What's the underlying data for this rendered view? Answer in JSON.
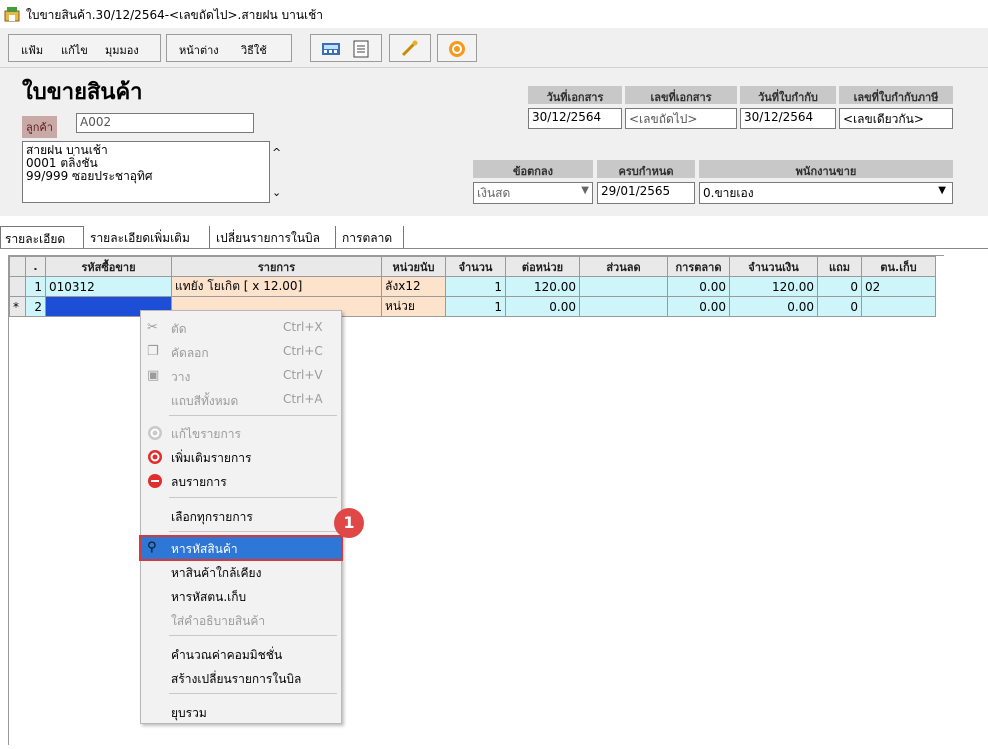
{
  "window": {
    "title": "ใบขายสินค้า.30/12/2564-<เลขถัดไป>.สายฝน บานเช้า"
  },
  "toolbar": {
    "menu": [
      "แฟ้ม",
      "แก้ไข",
      "มุมมอง"
    ],
    "menu2": [
      "หน้าต่าง",
      "วิธีใช้"
    ]
  },
  "document": {
    "heading": "ใบขายสินค้า",
    "customer_label": "ลูกค้า",
    "customer_code": "A002",
    "address": [
      "สายฝน บานเช้า",
      "0001 ตลิ่งชัน",
      "99/999 ซอยประชาอุทิศ"
    ],
    "doc_date_label": "วันที่เอกสาร",
    "doc_no_label": "เลขที่เอกสาร",
    "inv_date_label": "วันที่ใบกำกับ",
    "tax_no_label": "เลขที่ใบกำกับภาษี",
    "doc_date": "30/12/2564",
    "doc_no": "<เลขถัดไป>",
    "inv_date": "30/12/2564",
    "tax_no": "<เลขเดียวกัน>",
    "terms_label": "ข้อตกลง",
    "due_label": "ครบกำหนด",
    "sales_label": "พนักงานขาย",
    "terms": "เงินสด",
    "due": "29/01/2565",
    "sales": "0.ขายเอง"
  },
  "tabs": [
    "รายละเอียด",
    "รายละเอียดเพิ่มเติม",
    "เปลี่ยนรายการในบิล",
    "การตลาด"
  ],
  "grid": {
    "headers": [
      ".",
      "รหัสซื้อขาย",
      "รายการ",
      "หน่วยนับ",
      "จำนวน",
      "ต่อหน่วย",
      "ส่วนลด",
      "การตลาด",
      "จำนวนเงิน",
      "แถม",
      "ตน.เก็บ"
    ],
    "rows": [
      {
        "mark": "",
        "no": "1",
        "code": "010312",
        "desc": "แทยัง โยเกิต [ x 12.00]",
        "unit": "ลังx12",
        "qty": "1",
        "price": "120.00",
        "disc": "",
        "mkt": "0.00",
        "amount": "120.00",
        "free": "0",
        "store": "02"
      },
      {
        "mark": "*",
        "no": "2",
        "code": "",
        "desc": "",
        "unit": "หน่วย",
        "qty": "1",
        "price": "0.00",
        "disc": "",
        "mkt": "0.00",
        "amount": "0.00",
        "free": "0",
        "store": ""
      }
    ]
  },
  "context_menu": {
    "cut": "ตัด",
    "cut_key": "Ctrl+X",
    "copy": "คัดลอก",
    "copy_key": "Ctrl+C",
    "paste": "วาง",
    "paste_key": "Ctrl+V",
    "select_all": "แถบสีทั้งหมด",
    "select_all_key": "Ctrl+A",
    "edit": "แก้ไขรายการ",
    "add": "เพิ่มเติมรายการ",
    "delete": "ลบรายการ",
    "select_items": "เลือกทุกรายการ",
    "find_code": "หารหัสสินค้า",
    "find_near": "หาสินค้าใกล้เคียง",
    "find_store": "หารหัสตน.เก็บ",
    "desc": "ใส่คำอธิบายสินค้า",
    "commission": "คำนวณค่าคอมมิชชั่น",
    "create_change": "สร้างเปลี่ยนรายการในบิล",
    "collapse": "ยุบรวม"
  },
  "annotation": {
    "step": "1"
  },
  "colors": {
    "highlight": "#2f77d6",
    "row": "#cdf5fa",
    "badge": "#e04848"
  }
}
